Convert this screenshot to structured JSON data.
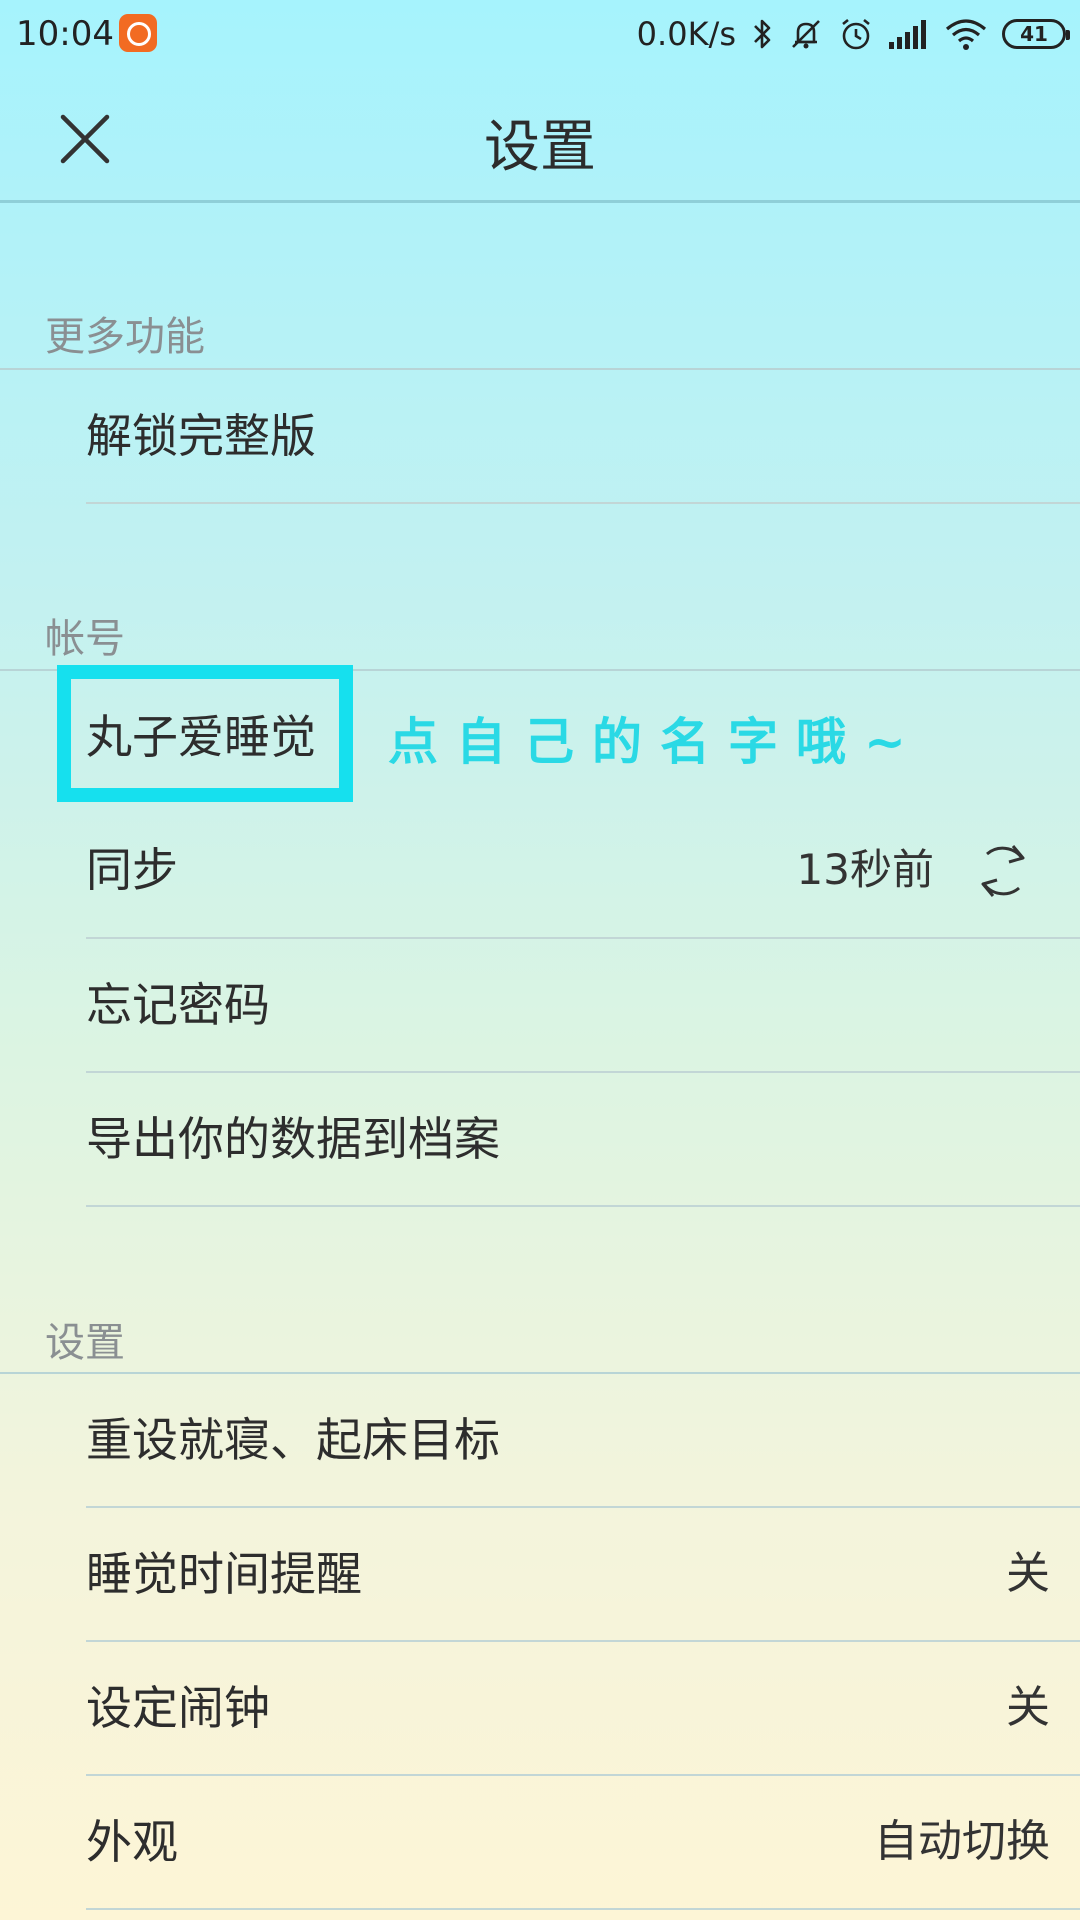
{
  "status_bar": {
    "time": "10:04",
    "net_speed": "0.0K/s",
    "battery": "41",
    "icons": [
      "mi-app-icon",
      "bluetooth-icon",
      "mute-icon",
      "alarm-icon",
      "signal-icon",
      "wifi-icon",
      "battery-icon"
    ]
  },
  "app_bar": {
    "title": "设置",
    "close_icon": "close-icon"
  },
  "sections": {
    "more_features": {
      "header": "更多功能",
      "unlock_full": "解锁完整版"
    },
    "account": {
      "header": "帐号",
      "username": "丸子爱睡觉",
      "annotation": "点自己的名字哦~",
      "sync_label": "同步",
      "sync_time": "13秒前",
      "forgot_password": "忘记密码",
      "export_data": "导出你的数据到档案"
    },
    "settings": {
      "header": "设置",
      "reset_goals": "重设就寝、起床目标",
      "bedtime_reminder": "睡觉时间提醒",
      "bedtime_reminder_value": "关",
      "set_alarm": "设定闹钟",
      "set_alarm_value": "关",
      "appearance": "外观",
      "appearance_value": "自动切换"
    }
  },
  "colors": {
    "highlight": "#16e0ee",
    "annotation": "#2ad9e5",
    "mi_badge": "#f26b22"
  }
}
